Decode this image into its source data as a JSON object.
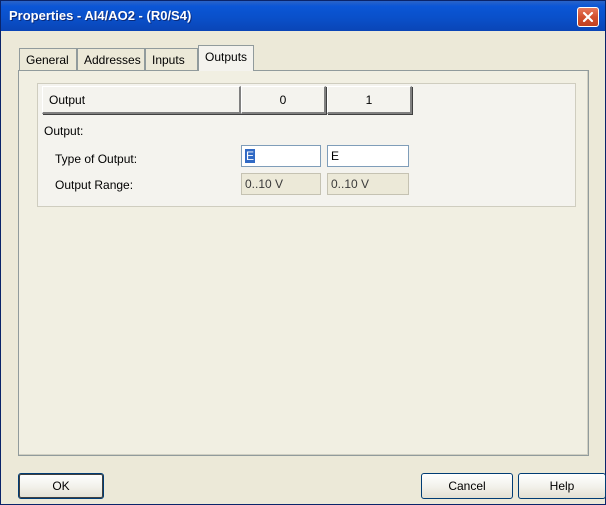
{
  "window": {
    "title": "Properties - AI4/AO2 - (R0/S4)",
    "accent": "#0a4fc8",
    "close_icon": "close-icon"
  },
  "tabs": [
    {
      "label": "General",
      "active": false
    },
    {
      "label": "Addresses",
      "active": false
    },
    {
      "label": "Inputs",
      "active": false
    },
    {
      "label": "Outputs",
      "active": true
    }
  ],
  "outputs": {
    "header": {
      "name": "Output",
      "columns": [
        "0",
        "1"
      ]
    },
    "section_label": "Output:",
    "rows": [
      {
        "label": "Type of Output:",
        "values": [
          "E",
          "E"
        ],
        "editable": true
      },
      {
        "label": "Output Range:",
        "values": [
          "0..10 V",
          "0..10 V"
        ],
        "editable": false
      }
    ]
  },
  "buttons": {
    "ok": "OK",
    "cancel": "Cancel",
    "help": "Help"
  }
}
